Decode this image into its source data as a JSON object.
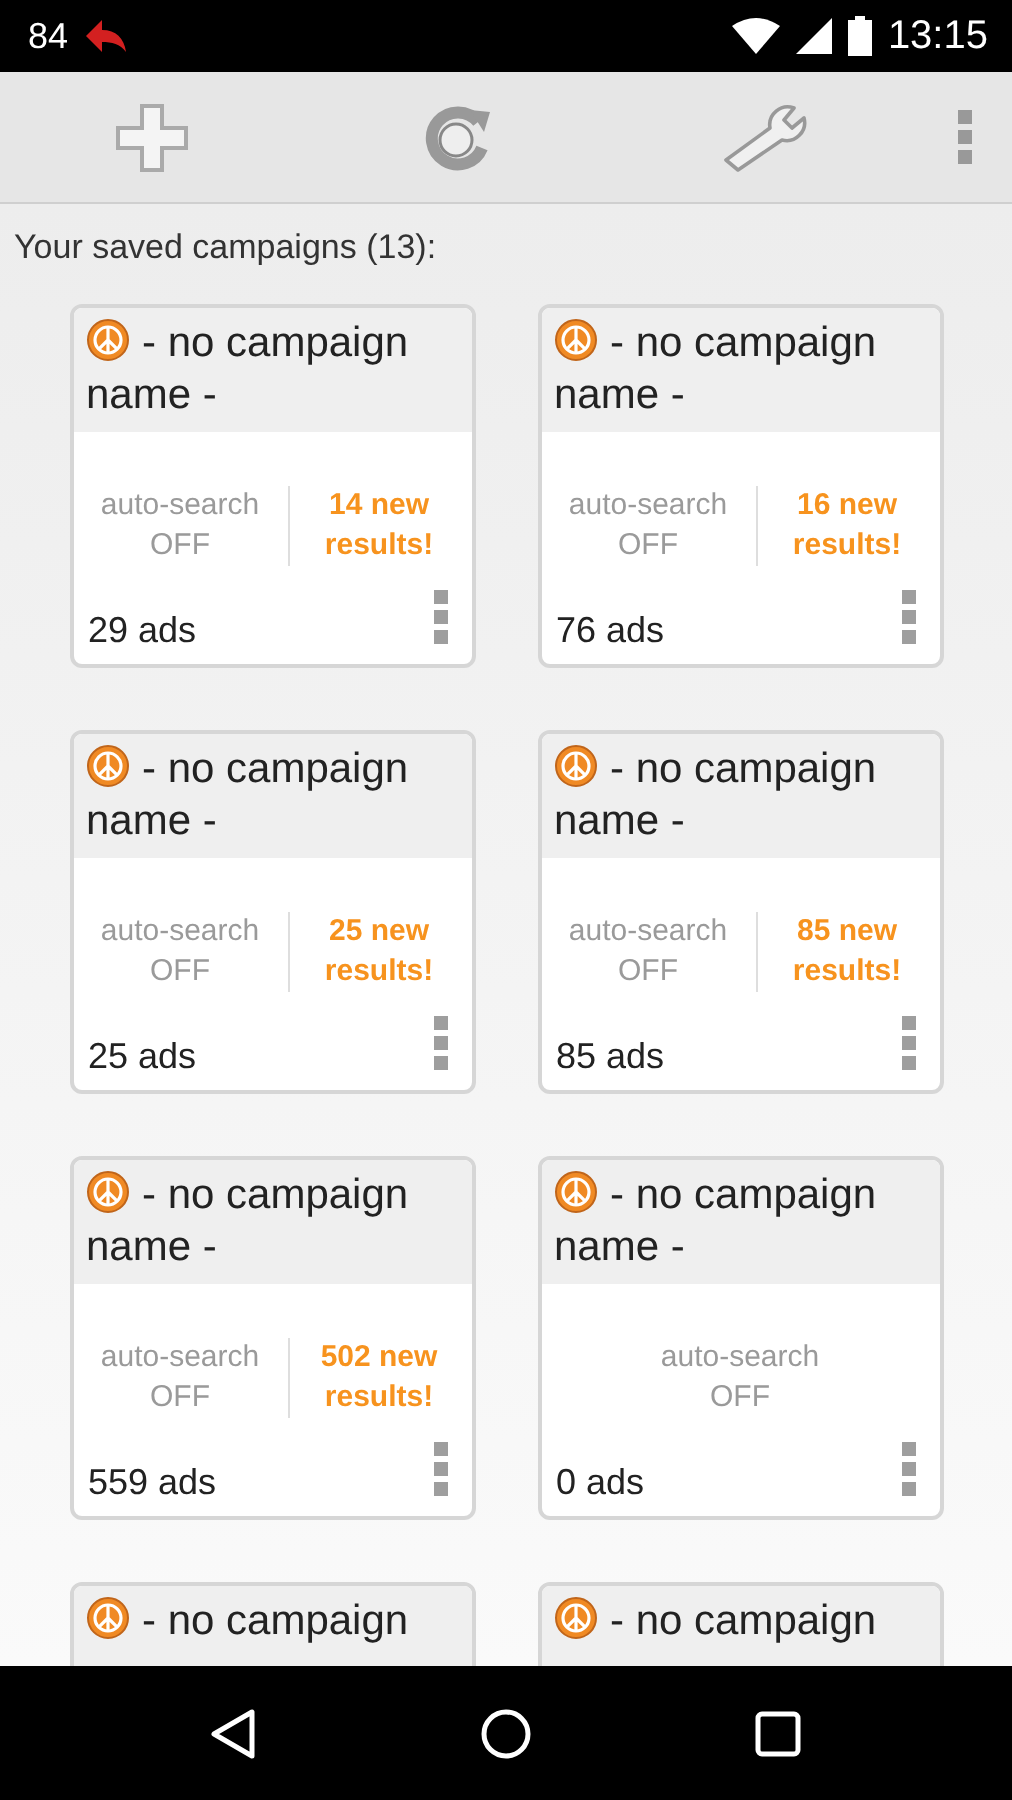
{
  "status_bar": {
    "notification_count": "84",
    "time": "13:15"
  },
  "heading": "Your saved campaigns (13):",
  "campaigns": [
    {
      "title": "- no campaign name -",
      "auto_search_label": "auto-search",
      "auto_search_state": "OFF",
      "new_results": "14 new results!",
      "ads": "29 ads"
    },
    {
      "title": "- no campaign name -",
      "auto_search_label": "auto-search",
      "auto_search_state": "OFF",
      "new_results": "16 new results!",
      "ads": "76 ads"
    },
    {
      "title": "- no campaign name -",
      "auto_search_label": "auto-search",
      "auto_search_state": "OFF",
      "new_results": "25 new results!",
      "ads": "25 ads"
    },
    {
      "title": "- no campaign name -",
      "auto_search_label": "auto-search",
      "auto_search_state": "OFF",
      "new_results": "85 new results!",
      "ads": "85 ads"
    },
    {
      "title": "- no campaign name -",
      "auto_search_label": "auto-search",
      "auto_search_state": "OFF",
      "new_results": "502 new results!",
      "ads": "559 ads"
    },
    {
      "title": "- no campaign name -",
      "auto_search_label": "auto-search",
      "auto_search_state": "OFF",
      "ads": "0 ads"
    },
    {
      "title": "- no campaign"
    },
    {
      "title": "- no campaign"
    }
  ]
}
